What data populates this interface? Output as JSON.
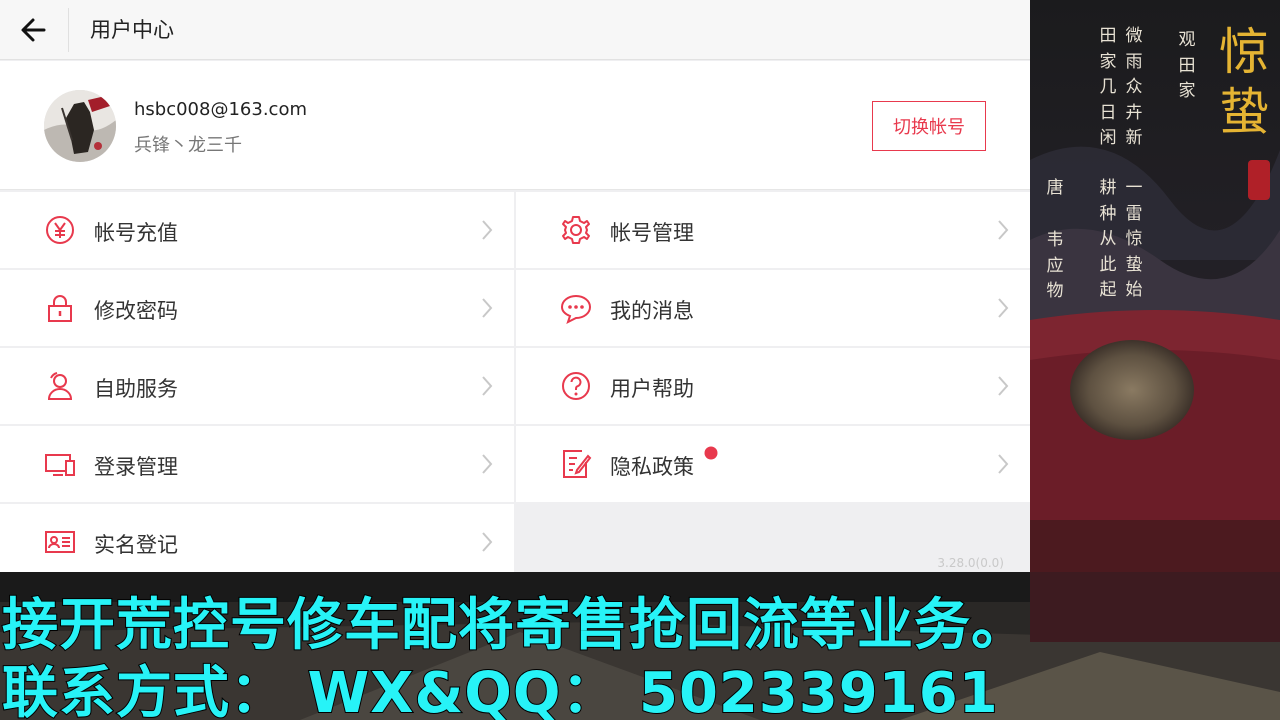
{
  "header": {
    "title": "用户中心",
    "back_icon": "arrow-left-icon"
  },
  "profile": {
    "email": "hsbc008@163.com",
    "nickname": "兵锋丶龙三千",
    "switch_button": "切换帐号"
  },
  "menu": {
    "left": [
      {
        "label": "帐号充值",
        "icon": "yen-circle-icon"
      },
      {
        "label": "修改密码",
        "icon": "lock-icon"
      },
      {
        "label": "自助服务",
        "icon": "user-service-icon"
      },
      {
        "label": "登录管理",
        "icon": "devices-icon"
      },
      {
        "label": "实名登记",
        "icon": "id-card-icon"
      }
    ],
    "right": [
      {
        "label": "帐号管理",
        "icon": "gear-icon"
      },
      {
        "label": "我的消息",
        "icon": "chat-bubble-icon"
      },
      {
        "label": "用户帮助",
        "icon": "help-circle-icon"
      },
      {
        "label": "隐私政策",
        "icon": "edit-document-icon",
        "badge": true
      }
    ]
  },
  "version": "3.28.0(0.0)",
  "poem": {
    "title": "惊蛰",
    "col1": "观田家",
    "col2": "微雨众卉新",
    "col3": "田家几日闲",
    "col4": "一雷惊蛰始",
    "col5": "耕种从此起",
    "col6": "唐",
    "col7": "韦应物"
  },
  "banner": {
    "line1": "接开荒控号修车配将寄售抢回流等业务。",
    "line2": "联系方式： WX&QQ： 502339161"
  },
  "colors": {
    "accent": "#e8394d",
    "banner_text": "#27f3f7",
    "poem_title": "#e5b433"
  }
}
